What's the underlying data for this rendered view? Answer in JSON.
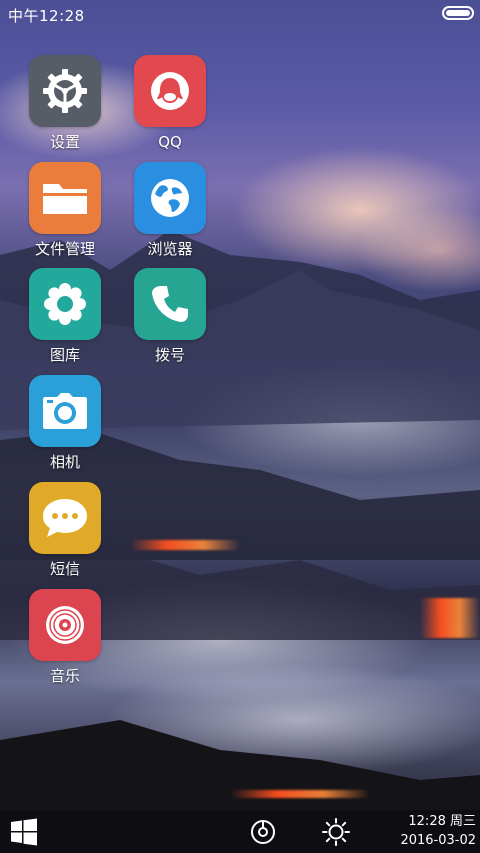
{
  "status_bar": {
    "time": "中午12:28"
  },
  "apps": [
    {
      "label": "设置",
      "icon": "gear-icon",
      "color": "#575d66"
    },
    {
      "label": "QQ",
      "icon": "qq-penguin-icon",
      "color": "#e2494f"
    },
    {
      "label": "文件管理",
      "icon": "folder-icon",
      "color": "#eb7d3c"
    },
    {
      "label": "浏览器",
      "icon": "globe-icon",
      "color": "#2a8fe0"
    },
    {
      "label": "图库",
      "icon": "flower-icon",
      "color": "#22a99b"
    },
    {
      "label": "拨号",
      "icon": "phone-icon",
      "color": "#25a592"
    },
    {
      "label": "相机",
      "icon": "camera-icon",
      "color": "#2a9fd8"
    },
    {
      "label": "短信",
      "icon": "chat-bubble-icon",
      "color": "#e0a928"
    },
    {
      "label": "音乐",
      "icon": "music-disc-icon",
      "color": "#dc4550"
    }
  ],
  "taskbar": {
    "start_icon": "windows-logo-icon",
    "music_icon": "music-disc-icon",
    "brightness_icon": "brightness-sun-icon",
    "clock_time": "12:28 周三",
    "clock_date": "2016-03-02"
  }
}
